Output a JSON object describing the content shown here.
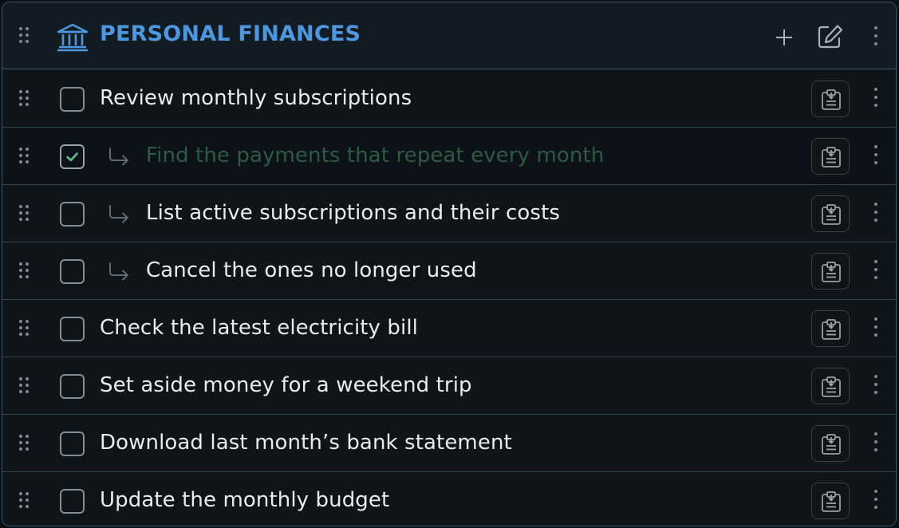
{
  "header": {
    "title": "PERSONAL FINANCES",
    "icon": "bank-icon",
    "actions": [
      "plus-icon",
      "edit-icon",
      "kebab-menu-icon"
    ]
  },
  "tasks": [
    {
      "text": "Review monthly subscriptions",
      "checked": false,
      "subtask": false
    },
    {
      "text": "Find the payments that repeat every month",
      "checked": true,
      "subtask": true
    },
    {
      "text": "List active subscriptions and their costs",
      "checked": false,
      "subtask": true
    },
    {
      "text": "Cancel the ones no longer used",
      "checked": false,
      "subtask": true
    },
    {
      "text": "Check the latest electricity bill",
      "checked": false,
      "subtask": false
    },
    {
      "text": "Set aside money for a weekend trip",
      "checked": false,
      "subtask": false
    },
    {
      "text": "Download last month’s bank statement",
      "checked": false,
      "subtask": false
    },
    {
      "text": "Update the monthly budget",
      "checked": false,
      "subtask": false
    }
  ],
  "colors": {
    "accent": "#4c97df",
    "border": "#3a5872",
    "done_text": "#2d5a42",
    "check": "#5cbf8a"
  }
}
